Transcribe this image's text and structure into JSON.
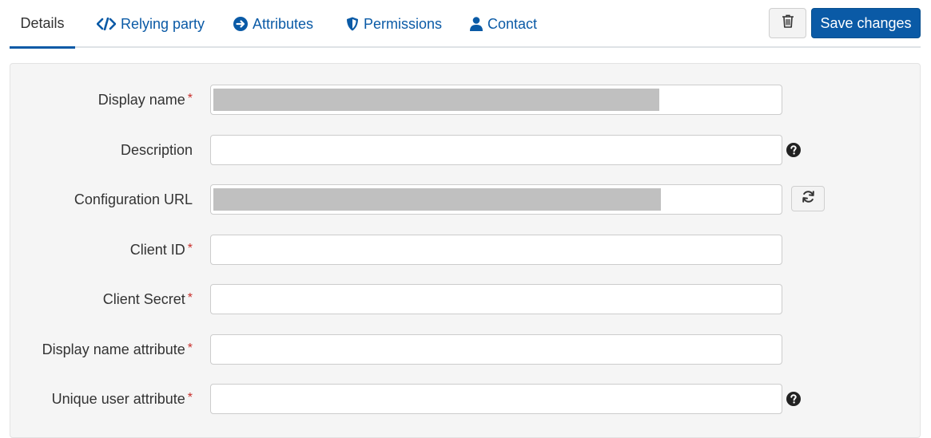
{
  "tabs": [
    {
      "label": "Details",
      "icon": "",
      "active": true
    },
    {
      "label": "Relying party",
      "icon": "code-icon",
      "active": false
    },
    {
      "label": "Attributes",
      "icon": "arrow-circle-right-icon",
      "active": false
    },
    {
      "label": "Permissions",
      "icon": "shield-icon",
      "active": false
    },
    {
      "label": "Contact",
      "icon": "user-icon",
      "active": false
    }
  ],
  "actions": {
    "delete_icon": "trash-icon",
    "save_label": "Save changes"
  },
  "form": {
    "required_mark": "*",
    "fields": [
      {
        "label": "Display name",
        "required": true,
        "value": "",
        "redacted": true
      },
      {
        "label": "Description",
        "required": false,
        "value": "",
        "help": true
      },
      {
        "label": "Configuration URL",
        "required": false,
        "value": "",
        "redacted": true,
        "refresh": true
      },
      {
        "label": "Client ID",
        "required": true,
        "value": ""
      },
      {
        "label": "Client Secret",
        "required": true,
        "value": ""
      },
      {
        "label": "Display name attribute",
        "required": true,
        "value": ""
      },
      {
        "label": "Unique user attribute",
        "required": true,
        "value": "",
        "help": true
      }
    ]
  },
  "colors": {
    "accent": "#0a5aa6",
    "required": "#c9302c",
    "panel_bg": "#f5f5f5"
  }
}
